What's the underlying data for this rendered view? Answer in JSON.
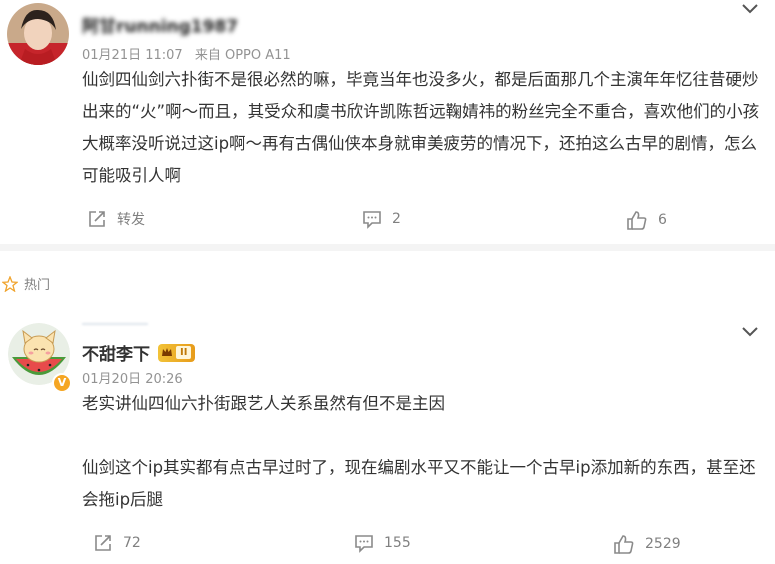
{
  "comments": [
    {
      "username": "阿甘running1987",
      "date": "01月21日 11:07",
      "source": "来自 OPPO A11",
      "text": [
        "仙剑四仙剑六扑街不是很必然的嘛，毕竟当年也没多火，都是后面那几个主演年年忆往昔硬炒出来的“火”啊～而且，其受众和虞书欣许凯陈哲远鞠婧祎的粉丝完全不重合，喜欢他们的小孩大概率没听说过这ip啊～再有古偶仙侠本身就审美疲劳的情况下，还拍这么古早的剧情，怎么可能吸引人啊"
      ],
      "actions": {
        "repost": "转发",
        "comments": "2",
        "likes": "6"
      }
    },
    {
      "username": "不甜李下",
      "date": "01月20日 20:26",
      "level": "II",
      "text": [
        "老实讲仙四仙六扑街跟艺人关系虽然有但不是主因",
        "仙剑这个ip其实都有点古早过时了，现在编剧水平又不能让一个古早ip添加新的东西，甚至还会拖ip后腿"
      ],
      "actions": {
        "repost": "72",
        "comments": "155",
        "likes": "2529"
      }
    }
  ],
  "section": {
    "hot_label": "热门"
  },
  "colors": {
    "meta_gray": "#939393",
    "divider": "#f4f4f4",
    "badge_gold": "#f2c338"
  },
  "icons": [
    "chevron-down-icon",
    "repost-icon",
    "comment-icon",
    "like-icon",
    "hot-icon",
    "verified-icon",
    "level-badge-icon"
  ]
}
